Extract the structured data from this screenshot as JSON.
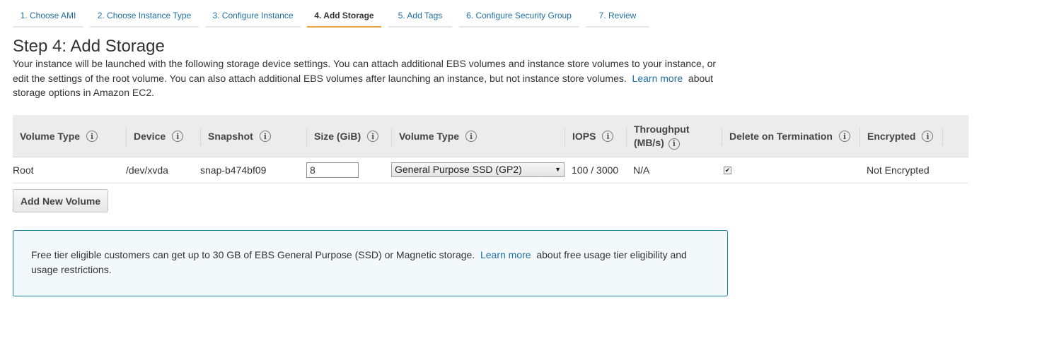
{
  "wizard": {
    "tabs": [
      {
        "label": "1. Choose AMI"
      },
      {
        "label": "2. Choose Instance Type"
      },
      {
        "label": "3. Configure Instance"
      },
      {
        "label": "4. Add Storage"
      },
      {
        "label": "5. Add Tags"
      },
      {
        "label": "6. Configure Security Group"
      },
      {
        "label": "7. Review"
      }
    ],
    "active_tab": "4. Add Storage"
  },
  "page": {
    "title": "Step 4: Add Storage",
    "intro_part1": "Your instance will be launched with the following storage device settings. You can attach additional EBS volumes and instance store volumes to your instance, or edit the settings of the root volume. You can also attach additional EBS volumes after launching an instance, but not instance store volumes.",
    "intro_link": "Learn more",
    "intro_part2": "about storage options in Amazon EC2."
  },
  "storage_table": {
    "headers": {
      "volume_type": "Volume Type",
      "device": "Device",
      "snapshot": "Snapshot",
      "size": "Size (GiB)",
      "volume_type2": "Volume Type",
      "iops": "IOPS",
      "throughput_line1": "Throughput",
      "throughput_line2": "(MB/s)",
      "delete_on_termination": "Delete on Termination",
      "encrypted": "Encrypted"
    },
    "info_icon_glyph": "i",
    "rows": [
      {
        "volume_type": "Root",
        "device": "/dev/xvda",
        "snapshot": "snap-b474bf09",
        "size": "8",
        "volume_type_select": "General Purpose SSD (GP2)",
        "iops": "100 / 3000",
        "throughput": "N/A",
        "delete_on_termination": true,
        "encrypted": "Not Encrypted"
      }
    ]
  },
  "actions": {
    "add_volume_label": "Add New Volume"
  },
  "info_box": {
    "text_part1": "Free tier eligible customers can get up to 30 GB of EBS General Purpose (SSD) or Magnetic storage.",
    "link": "Learn more",
    "text_part2": "about free usage tier eligibility and usage restrictions."
  },
  "colors": {
    "link": "#1f6fa3",
    "active_tab_underline": "#e8a33d",
    "info_box_border": "#1f7ea8",
    "header_bg": "#ececec"
  }
}
